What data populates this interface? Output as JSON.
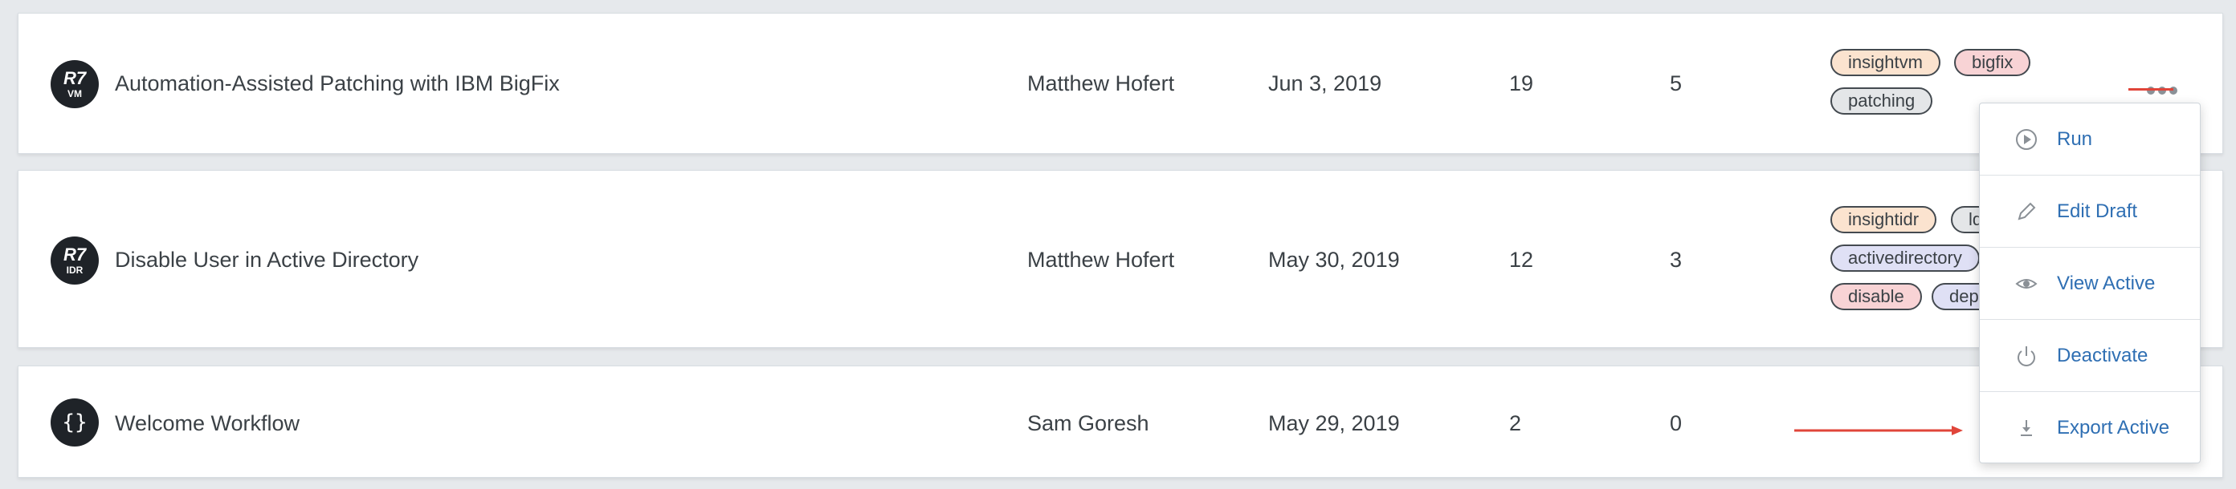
{
  "rows": [
    {
      "badge": {
        "logo": "R7",
        "abbr": "VM"
      },
      "name": "Automation-Assisted Patching with IBM BigFix",
      "author": "Matthew Hofert",
      "date": "Jun 3, 2019",
      "count1": "19",
      "count2": "5",
      "tags": [
        "insightvm",
        "bigfix",
        "patching"
      ]
    },
    {
      "badge": {
        "logo": "R7",
        "abbr": "IDR"
      },
      "name": "Disable User in Active Directory",
      "author": "Matthew Hofert",
      "date": "May 30, 2019",
      "count1": "12",
      "count2": "3",
      "tags": [
        "insightidr",
        "ld",
        "activedirectory",
        "disable",
        "dep"
      ]
    },
    {
      "badge": {
        "logo": "{}",
        "abbr": ""
      },
      "name": "Welcome Workflow",
      "author": "Sam Goresh",
      "date": "May 29, 2019",
      "count1": "2",
      "count2": "0",
      "tags": []
    }
  ],
  "menu": {
    "items": [
      {
        "label": "Run",
        "icon": "play-circle-icon"
      },
      {
        "label": "Edit Draft",
        "icon": "pencil-icon"
      },
      {
        "label": "View Active",
        "icon": "eye-icon"
      },
      {
        "label": "Deactivate",
        "icon": "power-icon"
      },
      {
        "label": "Export Active",
        "icon": "download-icon"
      }
    ]
  },
  "colors": {
    "accent_link": "#2f6fb3",
    "annotation_red": "#e0453a",
    "tag_peach": "#fbe3cf",
    "tag_pink": "#f8d3d5",
    "tag_gray": "#e4e6e8",
    "tag_lavender": "#dfe0f5"
  }
}
